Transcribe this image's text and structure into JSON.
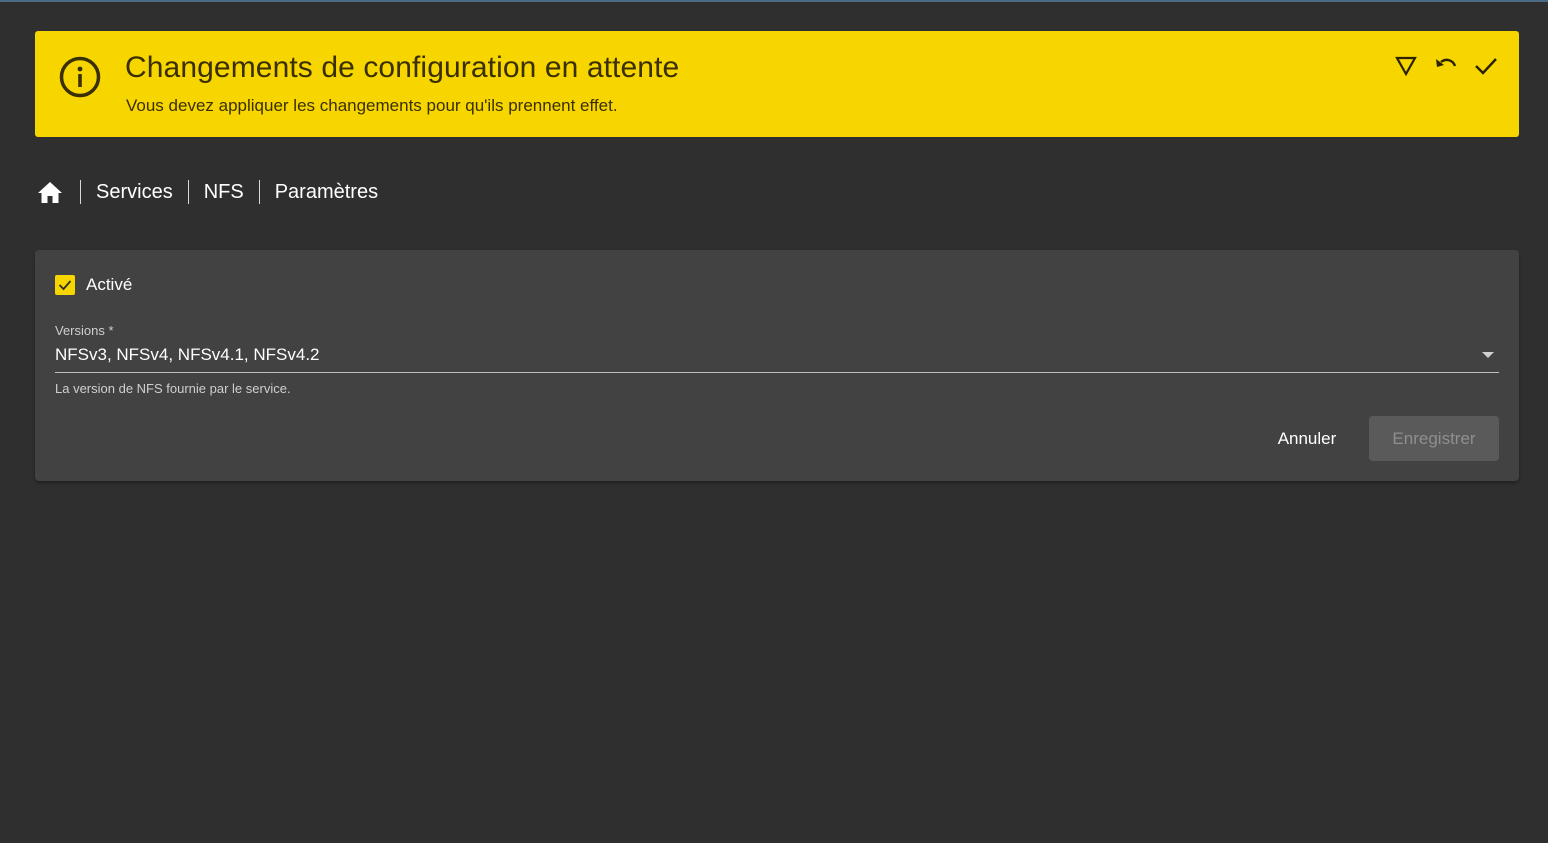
{
  "banner": {
    "title": "Changements de configuration en attente",
    "subtitle": "Vous devez appliquer les changements pour qu'ils prennent effet.",
    "icon": "info-icon",
    "actions": [
      {
        "name": "filter-icon"
      },
      {
        "name": "undo-icon"
      },
      {
        "name": "check-icon"
      }
    ],
    "color": "#f7d600"
  },
  "breadcrumb": {
    "home_icon": "home-icon",
    "items": [
      "Services",
      "NFS",
      "Paramètres"
    ]
  },
  "form": {
    "enabled_label": "Activé",
    "enabled_checked": true,
    "versions_label": "Versions *",
    "versions_value": "NFSv3, NFSv4, NFSv4.1, NFSv4.2",
    "versions_hint": "La version de NFS fournie par le service.",
    "cancel_label": "Annuler",
    "save_label": "Enregistrer",
    "save_disabled": true
  },
  "colors": {
    "background": "#2f2f2f",
    "card": "#424242",
    "accent": "#f7d600"
  }
}
